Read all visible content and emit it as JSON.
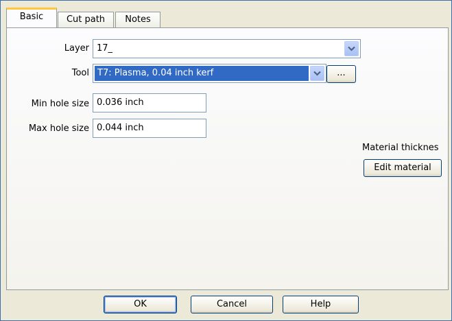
{
  "tabs": [
    {
      "label": "Basic",
      "active": true
    },
    {
      "label": "Cut path",
      "active": false
    },
    {
      "label": "Notes",
      "active": false
    }
  ],
  "basic": {
    "layer": {
      "label": "Layer",
      "value": "17_"
    },
    "tool": {
      "label": "Tool",
      "value": "T7: Plasma, 0.04 inch kerf",
      "browse_label": "..."
    },
    "min_hole": {
      "label": "Min hole size",
      "value": "0.036 inch"
    },
    "max_hole": {
      "label": "Max hole size",
      "value": "0.044 inch"
    },
    "material": {
      "label": "Material thicknes",
      "button_label": "Edit material"
    }
  },
  "footer": {
    "ok_label": "OK",
    "cancel_label": "Cancel",
    "help_label": "Help"
  },
  "colors": {
    "selection": "#316ac5",
    "tab_highlight": "#ffc83c",
    "window_bg": "#ece9d8"
  }
}
